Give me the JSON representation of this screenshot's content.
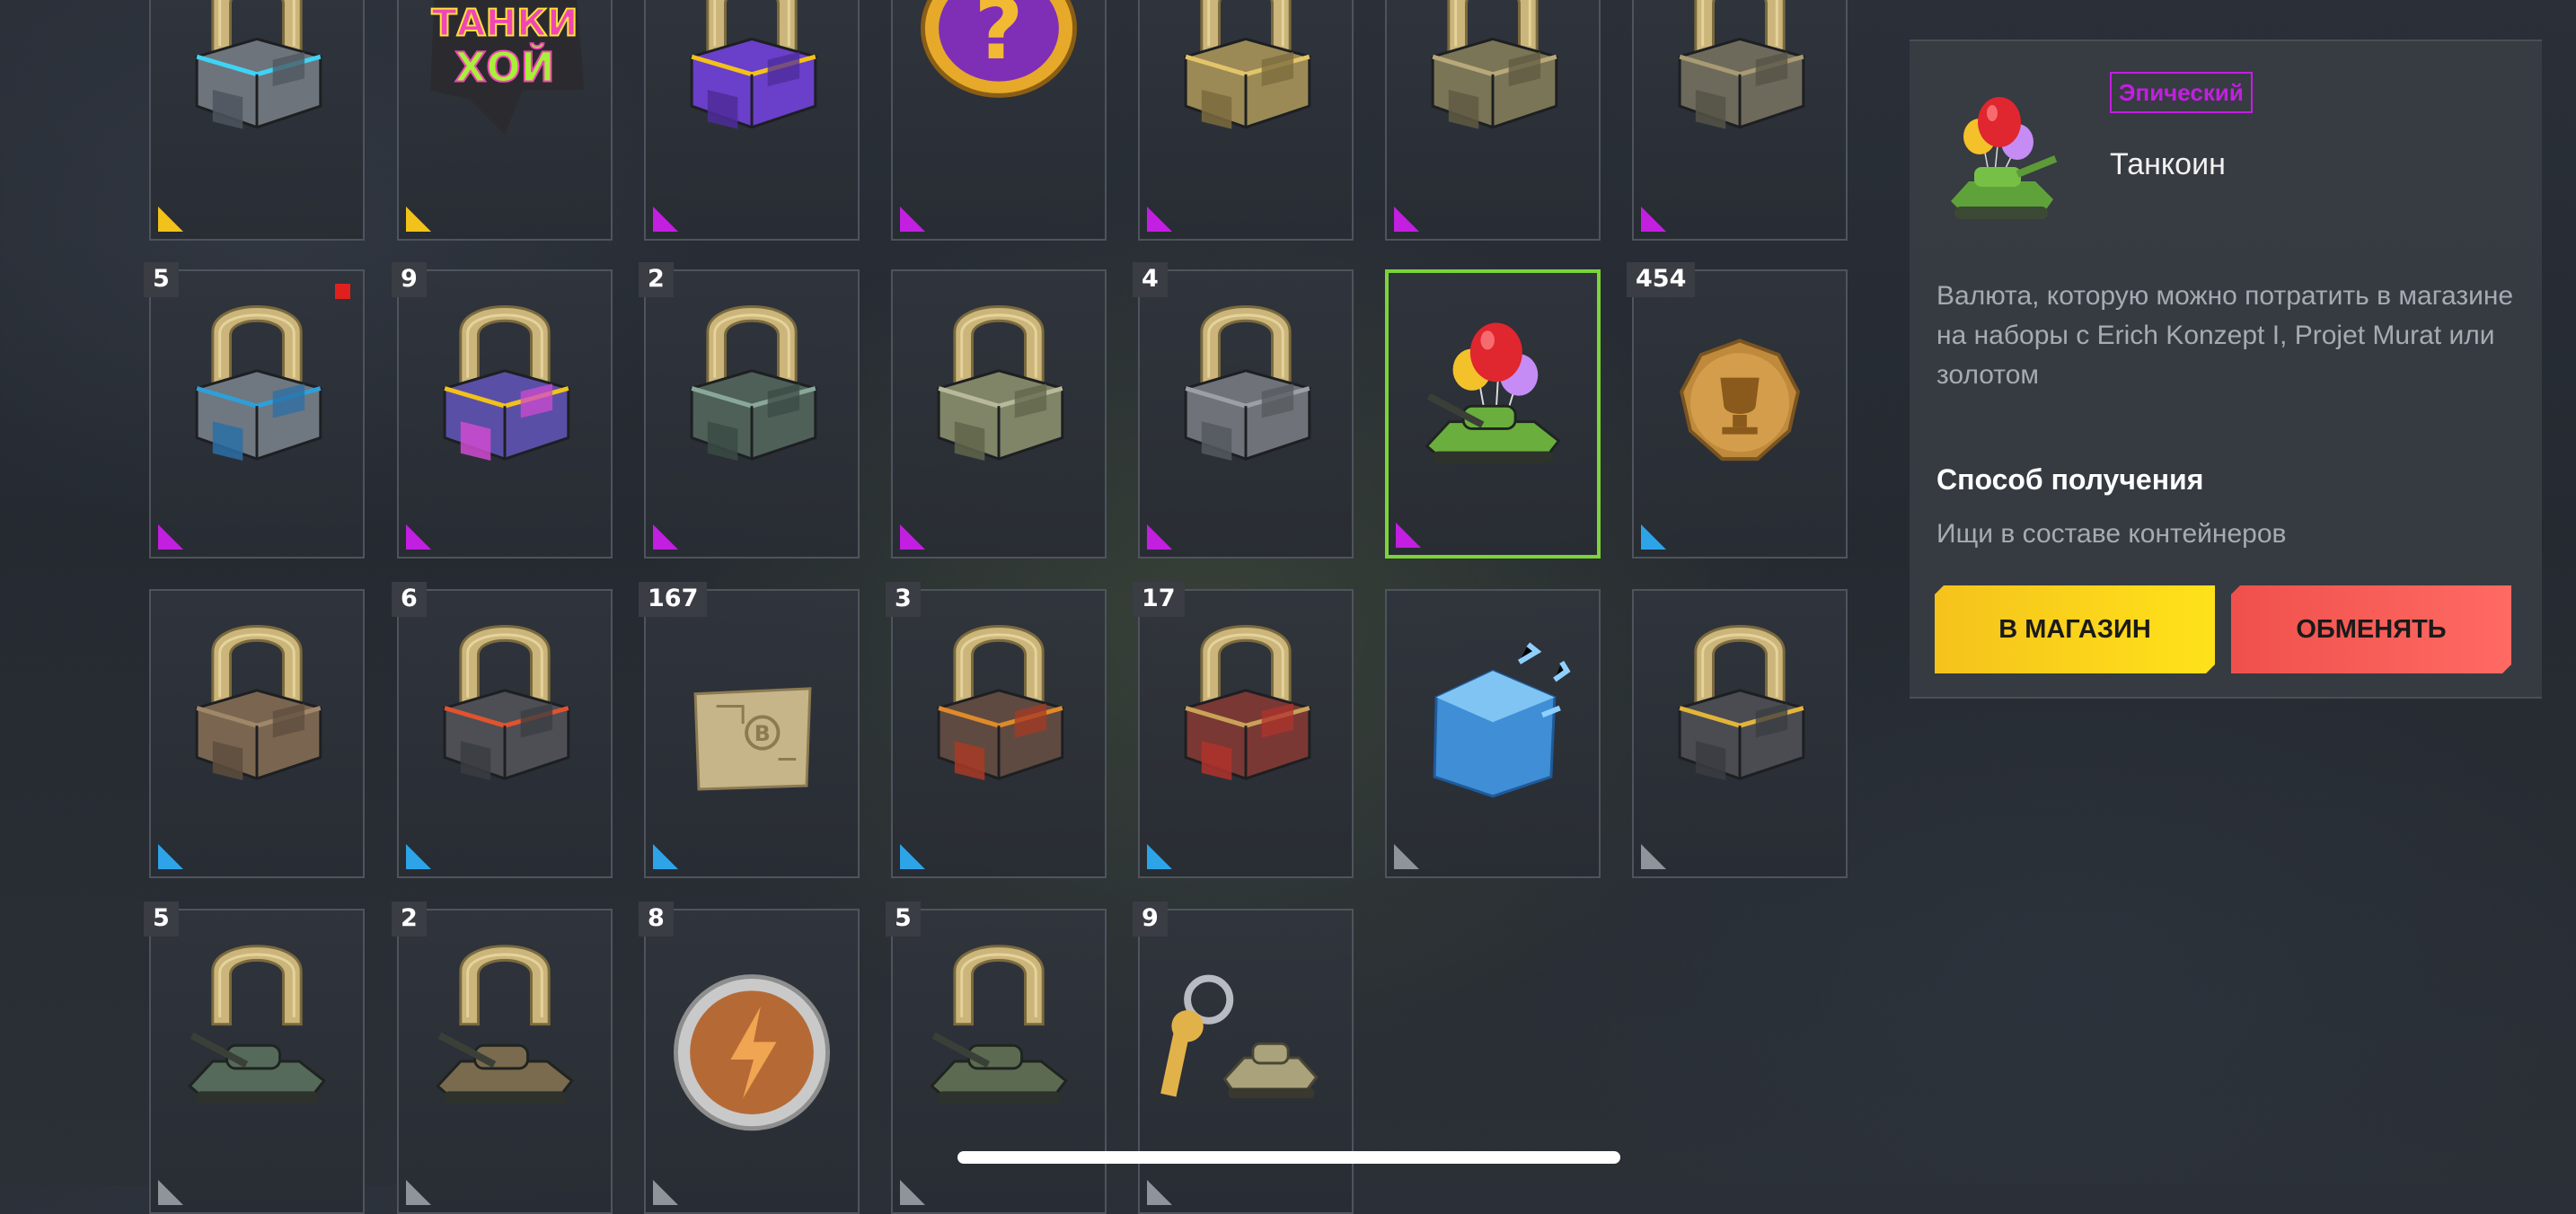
{
  "theme": {
    "epic_color": "#c21fe0",
    "legendary_color": "#f2c21a",
    "rare_color": "#2da4e8",
    "common_color": "#8e949a",
    "selected_border": "#7bd43a",
    "shop_button_color": "#ffd21a",
    "exchange_button_color": "#f45a55"
  },
  "inventory": {
    "rows": [
      [
        {
          "art": "horseshoe-steel-container",
          "rarity": "legendary",
          "count": null
        },
        {
          "art": "tanki-hoy-sticker",
          "rarity": "legendary",
          "count": null
        },
        {
          "art": "horseshoe-purple-mystery-container",
          "rarity": "epic",
          "count": null
        },
        {
          "art": "question-coin",
          "rarity": "epic",
          "count": null
        },
        {
          "art": "horseshoe-gold-container",
          "rarity": "epic",
          "count": null
        },
        {
          "art": "horseshoe-olive-container",
          "rarity": "epic",
          "count": null
        },
        {
          "art": "horseshoe-camo-container",
          "rarity": "epic",
          "count": null
        }
      ],
      [
        {
          "art": "horseshoe-blue-container",
          "rarity": "epic",
          "count": "5",
          "new": true
        },
        {
          "art": "horseshoe-neon-container",
          "rarity": "epic",
          "count": "9"
        },
        {
          "art": "horseshoe-thorn-container",
          "rarity": "epic",
          "count": "2"
        },
        {
          "art": "horseshoe-sandbag-container",
          "rarity": "epic",
          "count": null
        },
        {
          "art": "horseshoe-grey-container",
          "rarity": "epic",
          "count": "4"
        },
        {
          "art": "tankoin-balloons",
          "rarity": "epic",
          "count": null,
          "selected": true
        },
        {
          "art": "gold-trophy-coin",
          "rarity": "rare",
          "count": "454"
        }
      ],
      [
        {
          "art": "horseshoe-wood-container",
          "rarity": "rare",
          "count": null
        },
        {
          "art": "horseshoe-coral-container",
          "rarity": "rare",
          "count": "6"
        },
        {
          "art": "map-blueprint",
          "rarity": "rare",
          "count": "167"
        },
        {
          "art": "horseshoe-target-container",
          "rarity": "rare",
          "count": "3"
        },
        {
          "art": "horseshoe-red-container",
          "rarity": "rare",
          "count": "17"
        },
        {
          "art": "ice-crystal-cube",
          "rarity": "common",
          "count": null
        },
        {
          "art": "horseshoe-dark-gold-container",
          "rarity": "common",
          "count": null
        }
      ],
      [
        {
          "art": "horseshoe-green-tank",
          "rarity": "common",
          "count": "5"
        },
        {
          "art": "horseshoe-brown-tank",
          "rarity": "common",
          "count": "2"
        },
        {
          "art": "lightning-bronze-coin",
          "rarity": "common",
          "count": "8"
        },
        {
          "art": "horseshoe-olive-tank",
          "rarity": "common",
          "count": "5"
        },
        {
          "art": "key-with-tank-keychain",
          "rarity": "common",
          "count": "9"
        }
      ]
    ]
  },
  "detail": {
    "rarity_label": "Эпический",
    "title": "Танкоин",
    "icon": "tankoin-balloons-icon",
    "description": "Валюта, которую можно потратить в магазине на наборы с Erich Konzept I, Projet Murat или золотом",
    "obtain_heading": "Способ получения",
    "obtain_text": "Ищи в составе контейнеров",
    "shop_button": "В МАГАЗИН",
    "exchange_button": "ОБМЕНЯТЬ"
  }
}
